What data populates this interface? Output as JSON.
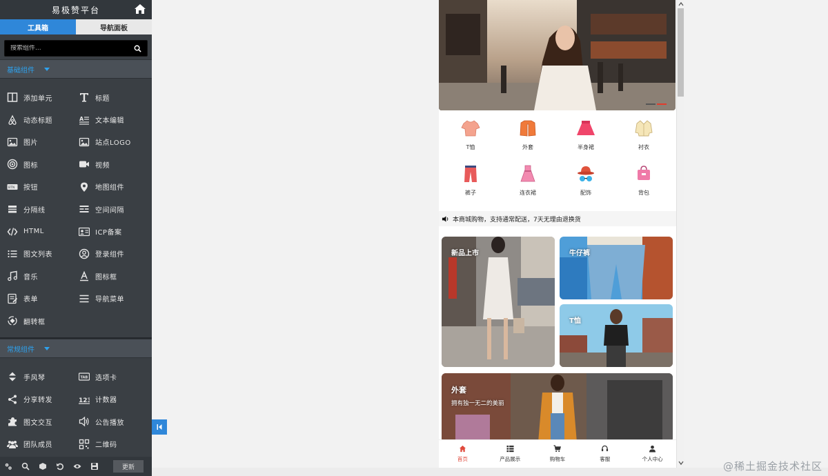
{
  "sidebar": {
    "title": "易极赞平台",
    "tabs": [
      {
        "label": "工具箱",
        "active": true
      },
      {
        "label": "导航面板",
        "active": false
      }
    ],
    "search_placeholder": "搜索组件...",
    "sections": [
      {
        "title": "基础组件",
        "items": [
          {
            "label": "添加单元",
            "icon": "columns-icon"
          },
          {
            "label": "标题",
            "icon": "title-t-icon"
          },
          {
            "label": "动态标题",
            "icon": "airbnb-icon"
          },
          {
            "label": "文本编辑",
            "icon": "text-edit-icon"
          },
          {
            "label": "图片",
            "icon": "image-icon"
          },
          {
            "label": "站点LOGO",
            "icon": "logo-image-icon"
          },
          {
            "label": "图标",
            "icon": "target-icon"
          },
          {
            "label": "视频",
            "icon": "video-icon"
          },
          {
            "label": "按钮",
            "icon": "btn-icon"
          },
          {
            "label": "地图组件",
            "icon": "map-pin-icon"
          },
          {
            "label": "分隔线",
            "icon": "separator-icon"
          },
          {
            "label": "空间间隔",
            "icon": "spacer-icon"
          },
          {
            "label": "HTML",
            "icon": "code-icon"
          },
          {
            "label": "ICP备案",
            "icon": "id-card-icon"
          },
          {
            "label": "图文列表",
            "icon": "list-icon"
          },
          {
            "label": "登录组件",
            "icon": "user-circle-icon"
          },
          {
            "label": "音乐",
            "icon": "music-icon"
          },
          {
            "label": "图标框",
            "icon": "font-a-icon"
          },
          {
            "label": "表单",
            "icon": "form-icon"
          },
          {
            "label": "导航菜单",
            "icon": "menu-icon"
          },
          {
            "label": "翻转框",
            "icon": "flip-icon"
          }
        ]
      },
      {
        "title": "常规组件",
        "items": [
          {
            "label": "手风琴",
            "icon": "sort-icon"
          },
          {
            "label": "选项卡",
            "icon": "tab-icon"
          },
          {
            "label": "分享转发",
            "icon": "share-icon"
          },
          {
            "label": "计数器",
            "icon": "counter-123-icon"
          },
          {
            "label": "图文交互",
            "icon": "puzzle-icon"
          },
          {
            "label": "公告播放",
            "icon": "speaker-icon"
          },
          {
            "label": "团队成员",
            "icon": "team-icon"
          },
          {
            "label": "二维码",
            "icon": "qrcode-icon"
          }
        ]
      }
    ],
    "bottom_icons": [
      "settings-icon",
      "search-icon",
      "cube-icon",
      "undo-icon",
      "eye-icon",
      "save-icon"
    ],
    "update_label": "更新"
  },
  "preview": {
    "categories": [
      {
        "label": "T恤",
        "icon": "tshirt-icon",
        "color": "#f4a38e"
      },
      {
        "label": "外套",
        "icon": "jacket-icon",
        "color": "#f07a3a"
      },
      {
        "label": "半身裙",
        "icon": "skirt-icon",
        "color": "#f0456a"
      },
      {
        "label": "衬衣",
        "icon": "shirt-icon",
        "color": "#f5e6b8"
      },
      {
        "label": "裤子",
        "icon": "pants-icon",
        "color": "#e85a5a"
      },
      {
        "label": "连衣裙",
        "icon": "dress-icon",
        "color": "#f28ab0"
      },
      {
        "label": "配饰",
        "icon": "hat-glasses-icon",
        "color": "#e0533c"
      },
      {
        "label": "背包",
        "icon": "bag-icon",
        "color": "#ef7aa8"
      }
    ],
    "notice": "本商城购物，支持通常配送，7天无理由退换货",
    "cards": {
      "new": "新品上市",
      "jeans": "牛仔裤",
      "tee": "T恤",
      "coat_title": "外套",
      "coat_sub": "拥有独一无二的美丽"
    },
    "tabbar": [
      {
        "label": "首页",
        "icon": "home-icon",
        "active": true
      },
      {
        "label": "产品展示",
        "icon": "grid-list-icon",
        "active": false
      },
      {
        "label": "购物车",
        "icon": "cart-icon",
        "active": false
      },
      {
        "label": "客服",
        "icon": "headset-icon",
        "active": false
      },
      {
        "label": "个人中心",
        "icon": "person-icon",
        "active": false
      }
    ],
    "accent": "#e04a3c"
  },
  "watermark": "@稀土掘金技术社区"
}
